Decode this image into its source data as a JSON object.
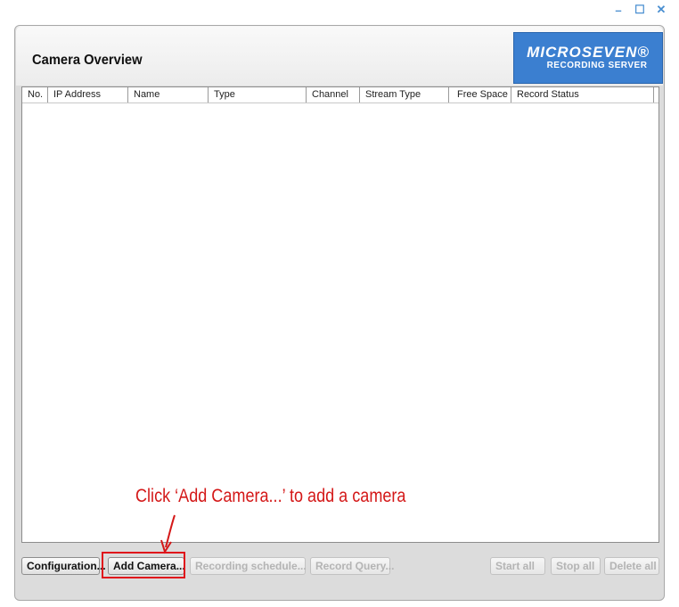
{
  "window": {
    "controls": [
      "–",
      "☐",
      "✕"
    ]
  },
  "header": {
    "title": "Camera Overview",
    "logo_line1": "MICROSEVEN®",
    "logo_line2": "RECORDING SERVER"
  },
  "table": {
    "columns": [
      "No.",
      "IP Address",
      "Name",
      "Type",
      "Channel",
      "Stream Type",
      "Free Space",
      "Record Status"
    ],
    "rows": []
  },
  "buttons": {
    "configuration": "Configuration...",
    "add_camera": "Add Camera...",
    "recording_schedule": "Recording schedule...",
    "record_query": "Record Query...",
    "start_all": "Start all",
    "stop_all": "Stop all",
    "delete_all": "Delete all"
  },
  "annotation": {
    "text": "Click ‘Add Camera...’ to add a camera",
    "color": "#d41818"
  },
  "colors": {
    "brand_blue": "#3b7fd0",
    "highlight_red": "#e0121b"
  }
}
